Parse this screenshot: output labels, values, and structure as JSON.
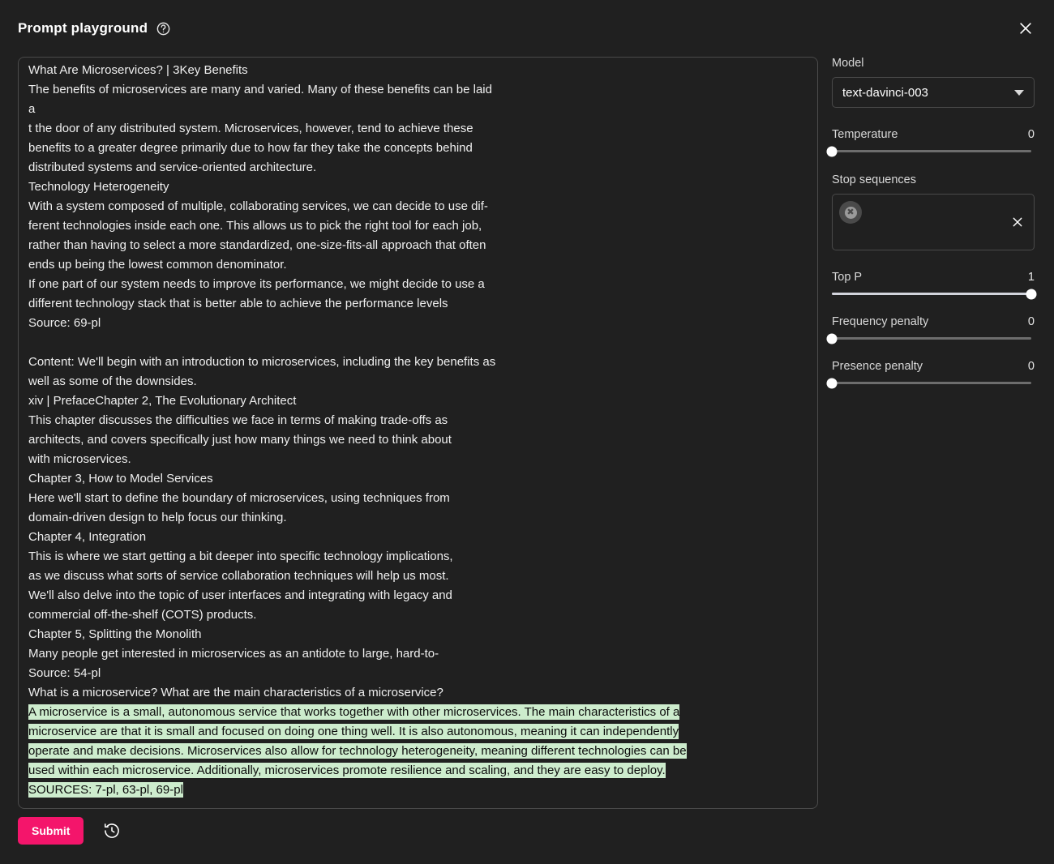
{
  "header": {
    "title": "Prompt playground",
    "help_icon": "question-circle-icon",
    "close_icon": "close-icon"
  },
  "editor": {
    "lines": [
      {
        "text": "What Are Microservices? | 3Key Benefits",
        "highlight": false
      },
      {
        "text": "The benefits of microservices are many and varied. Many of these benefits can be laid",
        "highlight": false
      },
      {
        "text": "a",
        "highlight": false
      },
      {
        "text": "t the door of any distributed system. Microservices, however, tend to achieve these",
        "highlight": false
      },
      {
        "text": "benefits to a greater degree primarily due to how far they take the concepts behind",
        "highlight": false
      },
      {
        "text": "distributed systems and service-oriented architecture.",
        "highlight": false
      },
      {
        "text": "Technology Heterogeneity",
        "highlight": false
      },
      {
        "text": "With a system composed of multiple, collaborating services, we can decide to use dif-",
        "highlight": false
      },
      {
        "text": "ferent technologies inside each one. This allows us to pick the right tool for each job,",
        "highlight": false
      },
      {
        "text": "rather than having to select a more standardized, one-size-fits-all approach that often",
        "highlight": false
      },
      {
        "text": "ends up being the lowest common denominator.",
        "highlight": false
      },
      {
        "text": "If one part of our system needs to improve its performance, we might decide to use a",
        "highlight": false
      },
      {
        "text": "different technology stack that is better able to achieve the performance levels",
        "highlight": false
      },
      {
        "text": "Source: 69-pl",
        "highlight": false
      },
      {
        "text": "",
        "highlight": false
      },
      {
        "text": "Content: We'll begin with an introduction to microservices, including the key benefits as",
        "highlight": false
      },
      {
        "text": "well as some of the downsides.",
        "highlight": false
      },
      {
        "text": "xiv | PrefaceChapter 2, The Evolutionary Architect",
        "highlight": false
      },
      {
        "text": "This chapter discusses the difficulties we face in terms of making trade-offs as",
        "highlight": false
      },
      {
        "text": "architects, and covers specifically just how many things we need to think about",
        "highlight": false
      },
      {
        "text": "with microservices.",
        "highlight": false
      },
      {
        "text": "Chapter 3, How to Model Services",
        "highlight": false
      },
      {
        "text": "Here we'll start to define the boundary of microservices, using techniques from",
        "highlight": false
      },
      {
        "text": "domain-driven design to help focus our thinking.",
        "highlight": false
      },
      {
        "text": "Chapter 4, Integration",
        "highlight": false
      },
      {
        "text": "This is where we start getting a bit deeper into specific technology implications,",
        "highlight": false
      },
      {
        "text": "as we discuss what sorts of service collaboration techniques will help us most.",
        "highlight": false
      },
      {
        "text": "We'll also delve into the topic of user interfaces and integrating with legacy and",
        "highlight": false
      },
      {
        "text": "commercial off-the-shelf (COTS) products.",
        "highlight": false
      },
      {
        "text": "Chapter 5, Splitting the Monolith",
        "highlight": false
      },
      {
        "text": "Many people get interested in microservices as an antidote to large, hard-to-",
        "highlight": false
      },
      {
        "text": "Source: 54-pl",
        "highlight": false
      },
      {
        "text": "What is a microservice? What are the main characteristics of a microservice?",
        "highlight": false
      },
      {
        "text": "A microservice is a small, autonomous service that works together with other microservices. The main characteristics of a",
        "highlight": true
      },
      {
        "text": "microservice are that it is small and focused on doing one thing well. It is also autonomous, meaning it can independently",
        "highlight": true
      },
      {
        "text": "operate and make decisions. Microservices also allow for technology heterogeneity, meaning different technologies can be",
        "highlight": true
      },
      {
        "text": "used within each microservice. Additionally, microservices promote resilience and scaling, and they are easy to deploy.",
        "highlight": true
      },
      {
        "text": "SOURCES: 7-pl, 63-pl, 69-pl",
        "highlight": true
      }
    ],
    "highlight_color": "#cdeccd",
    "highlight_text_color": "#0b0b0b"
  },
  "actions": {
    "submit_label": "Submit",
    "submit_color": "#f4156b",
    "history_icon": "history-clock-icon"
  },
  "panel": {
    "model": {
      "label": "Model",
      "value": "text-davinci-003",
      "caret_icon": "chevron-down-icon"
    },
    "temperature": {
      "label": "Temperature",
      "value": "0",
      "percent": 0
    },
    "stop_sequences": {
      "label": "Stop sequences",
      "chip_icon": "chip-remove-icon",
      "clear_icon": "clear-icon"
    },
    "top_p": {
      "label": "Top P",
      "value": "1",
      "percent": 100
    },
    "frequency_penalty": {
      "label": "Frequency penalty",
      "value": "0",
      "percent": 0
    },
    "presence_penalty": {
      "label": "Presence penalty",
      "value": "0",
      "percent": 0
    }
  }
}
